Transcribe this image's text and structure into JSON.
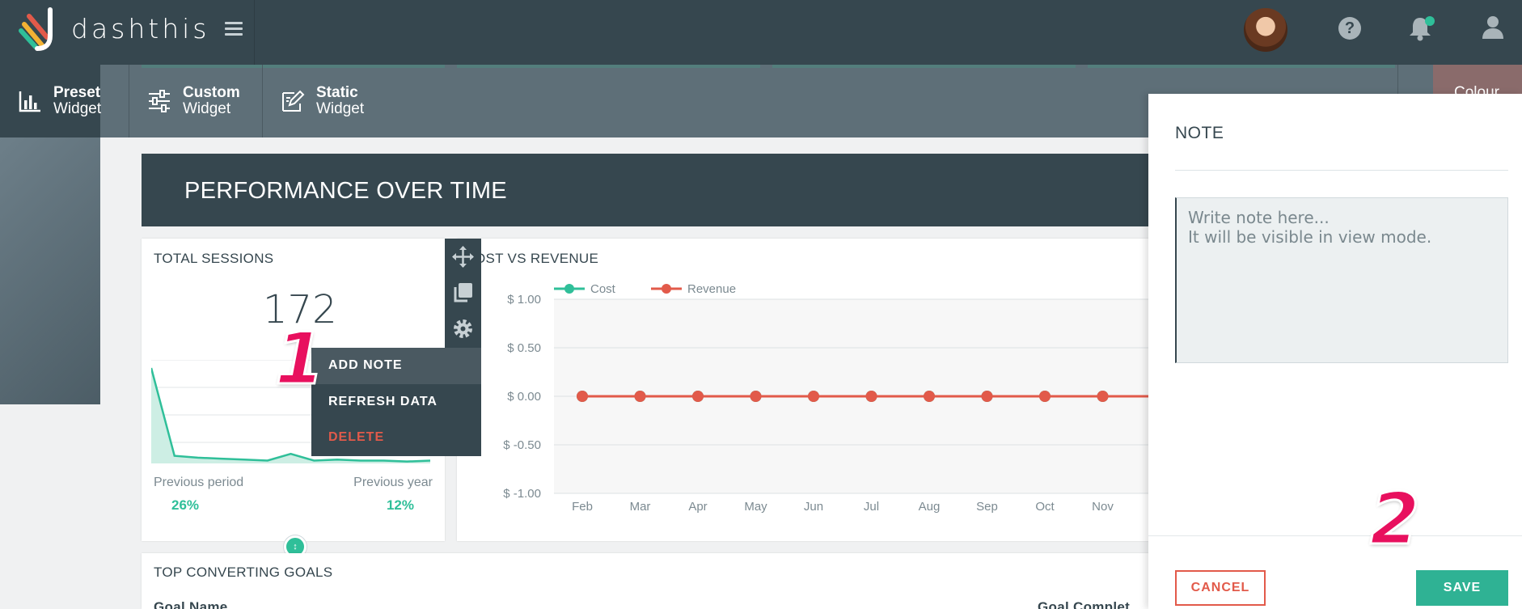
{
  "app": {
    "brand": "dashthis"
  },
  "header": {
    "help_icon": "help-icon",
    "bell_icon": "bell-icon",
    "user_icon": "user-icon"
  },
  "toolbar": {
    "items": [
      {
        "line1": "Preset",
        "line2": "Widget",
        "icon": "bar-chart-icon"
      },
      {
        "line1": "Custom",
        "line2": "Widget",
        "icon": "sliders-icon"
      },
      {
        "line1": "Static",
        "line2": "Widget",
        "icon": "edit-icon"
      }
    ],
    "colour_peek": "Colour"
  },
  "section": {
    "title": "PERFORMANCE OVER TIME"
  },
  "sessions_widget": {
    "title": "TOTAL SESSIONS",
    "value": "172",
    "previous_period_label": "Previous period",
    "previous_period_value": "26%",
    "previous_year_label": "Previous year",
    "previous_year_value": "12%"
  },
  "context_menu": {
    "items": [
      "ADD NOTE",
      "REFRESH DATA",
      "DELETE"
    ]
  },
  "annotations": {
    "one": "1",
    "two": "2"
  },
  "chart_data": {
    "type": "line",
    "title": "OST VS REVENUE",
    "series": [
      {
        "name": "Cost",
        "color": "#2fbf99",
        "values": [
          0,
          0,
          0,
          0,
          0,
          0,
          0,
          0,
          0,
          0
        ]
      },
      {
        "name": "Revenue",
        "color": "#e25a4a",
        "values": [
          0,
          0,
          0,
          0,
          0,
          0,
          0,
          0,
          0,
          0
        ]
      }
    ],
    "categories": [
      "Feb",
      "Mar",
      "Apr",
      "May",
      "Jun",
      "Jul",
      "Aug",
      "Sep",
      "Oct",
      "Nov"
    ],
    "ytick_labels": [
      "$ 1.00",
      "$ 0.50",
      "$ 0.00",
      "$ -0.50",
      "$ -1.00"
    ],
    "ylim": [
      -1,
      1
    ],
    "grid": true,
    "legend": "top-left"
  },
  "sparkline": {
    "values": [
      100,
      8,
      6,
      5,
      4,
      3,
      10,
      3,
      4,
      3,
      3,
      2,
      3
    ]
  },
  "bottom_widget": {
    "title": "TOP CONVERTING GOALS",
    "col1": "Goal Name",
    "col2": "Goal Complet"
  },
  "note_panel": {
    "title": "NOTE",
    "placeholder": "Write note here...\nIt will be visible in view mode.",
    "cancel_label": "CANCEL",
    "save_label": "SAVE"
  }
}
